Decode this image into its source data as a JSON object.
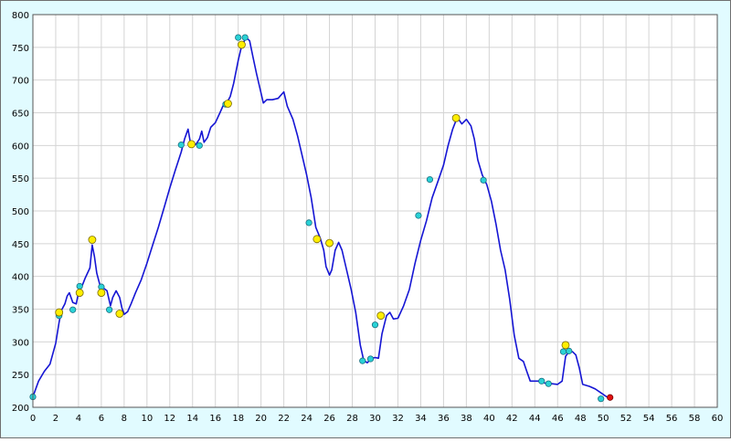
{
  "chart_data": {
    "type": "line",
    "title": "",
    "xlabel": "",
    "ylabel": "",
    "xlim": [
      0,
      60
    ],
    "ylim": [
      200,
      800
    ],
    "xticks": [
      0,
      2,
      4,
      6,
      8,
      10,
      12,
      14,
      16,
      18,
      20,
      22,
      24,
      26,
      28,
      30,
      32,
      34,
      36,
      38,
      40,
      42,
      44,
      46,
      48,
      50,
      52,
      54,
      56,
      58,
      60
    ],
    "yticks": [
      200,
      250,
      300,
      350,
      400,
      450,
      500,
      550,
      600,
      650,
      700,
      750,
      800
    ],
    "grid": true,
    "background": "#e1fbff",
    "plot_background": "#ffffff",
    "grid_color": "#d4d4d4",
    "line_color": "#1515d4",
    "series": [
      {
        "points": [
          [
            0,
            216
          ],
          [
            0.5,
            240
          ],
          [
            1,
            255
          ],
          [
            1.5,
            266
          ],
          [
            2,
            298
          ],
          [
            2.3,
            330
          ],
          [
            2.5,
            348
          ],
          [
            2.8,
            358
          ],
          [
            3,
            370
          ],
          [
            3.2,
            375
          ],
          [
            3.5,
            360
          ],
          [
            3.8,
            358
          ],
          [
            4,
            375
          ],
          [
            4.3,
            385
          ],
          [
            4.6,
            398
          ],
          [
            5,
            413
          ],
          [
            5.2,
            448
          ],
          [
            5.4,
            430
          ],
          [
            5.6,
            405
          ],
          [
            5.9,
            385
          ],
          [
            6.2,
            382
          ],
          [
            6.5,
            378
          ],
          [
            6.8,
            355
          ],
          [
            7,
            368
          ],
          [
            7.3,
            378
          ],
          [
            7.6,
            368
          ],
          [
            7.8,
            352
          ],
          [
            8,
            342
          ],
          [
            8.3,
            346
          ],
          [
            8.6,
            358
          ],
          [
            9,
            375
          ],
          [
            9.5,
            395
          ],
          [
            10,
            420
          ],
          [
            10.5,
            448
          ],
          [
            11,
            475
          ],
          [
            11.5,
            505
          ],
          [
            12,
            535
          ],
          [
            12.5,
            563
          ],
          [
            13,
            590
          ],
          [
            13.3,
            610
          ],
          [
            13.6,
            625
          ],
          [
            13.8,
            605
          ],
          [
            14,
            600
          ],
          [
            14.3,
            602
          ],
          [
            14.6,
            610
          ],
          [
            14.8,
            622
          ],
          [
            15,
            605
          ],
          [
            15.3,
            612
          ],
          [
            15.6,
            628
          ],
          [
            16,
            635
          ],
          [
            16.4,
            650
          ],
          [
            16.7,
            662
          ],
          [
            17,
            665
          ],
          [
            17.3,
            675
          ],
          [
            17.6,
            695
          ],
          [
            18,
            730
          ],
          [
            18.3,
            752
          ],
          [
            18.7,
            765
          ],
          [
            19,
            760
          ],
          [
            19.3,
            735
          ],
          [
            19.6,
            710
          ],
          [
            20,
            680
          ],
          [
            20.2,
            665
          ],
          [
            20.5,
            670
          ],
          [
            21,
            670
          ],
          [
            21.5,
            672
          ],
          [
            22,
            682
          ],
          [
            22.3,
            660
          ],
          [
            22.8,
            640
          ],
          [
            23.2,
            615
          ],
          [
            23.6,
            585
          ],
          [
            24,
            555
          ],
          [
            24.4,
            520
          ],
          [
            24.8,
            475
          ],
          [
            25.2,
            458
          ],
          [
            25.5,
            440
          ],
          [
            25.7,
            415
          ],
          [
            26,
            402
          ],
          [
            26.2,
            410
          ],
          [
            26.5,
            440
          ],
          [
            26.8,
            452
          ],
          [
            27.1,
            440
          ],
          [
            27.5,
            410
          ],
          [
            27.9,
            380
          ],
          [
            28.3,
            345
          ],
          [
            28.7,
            295
          ],
          [
            29,
            272
          ],
          [
            29.3,
            268
          ],
          [
            29.7,
            275
          ],
          [
            30,
            276
          ],
          [
            30.3,
            275
          ],
          [
            30.6,
            312
          ],
          [
            31,
            340
          ],
          [
            31.3,
            345
          ],
          [
            31.6,
            335
          ],
          [
            32,
            336
          ],
          [
            32.5,
            355
          ],
          [
            33,
            380
          ],
          [
            33.5,
            420
          ],
          [
            34,
            455
          ],
          [
            34.5,
            485
          ],
          [
            35,
            520
          ],
          [
            35.5,
            545
          ],
          [
            36,
            570
          ],
          [
            36.4,
            600
          ],
          [
            36.8,
            625
          ],
          [
            37.2,
            643
          ],
          [
            37.6,
            633
          ],
          [
            38,
            640
          ],
          [
            38.4,
            630
          ],
          [
            38.7,
            610
          ],
          [
            39,
            578
          ],
          [
            39.4,
            555
          ],
          [
            39.8,
            540
          ],
          [
            40.2,
            515
          ],
          [
            40.6,
            480
          ],
          [
            41,
            440
          ],
          [
            41.4,
            410
          ],
          [
            41.8,
            365
          ],
          [
            42.2,
            310
          ],
          [
            42.6,
            275
          ],
          [
            43,
            270
          ],
          [
            43.3,
            255
          ],
          [
            43.6,
            240
          ],
          [
            44,
            240
          ],
          [
            44.5,
            240
          ],
          [
            45,
            236
          ],
          [
            45.5,
            236
          ],
          [
            46,
            235
          ],
          [
            46.4,
            240
          ],
          [
            46.7,
            278
          ],
          [
            47,
            285
          ],
          [
            47.3,
            285
          ],
          [
            47.6,
            280
          ],
          [
            47.9,
            260
          ],
          [
            48.2,
            235
          ],
          [
            48.8,
            232
          ],
          [
            49.3,
            228
          ],
          [
            49.8,
            222
          ],
          [
            50.3,
            216
          ],
          [
            50.5,
            216
          ]
        ]
      }
    ],
    "markers": {
      "cyan": [
        [
          0,
          216
        ],
        [
          2.3,
          340
        ],
        [
          3.5,
          349
        ],
        [
          4.1,
          385
        ],
        [
          6.0,
          384
        ],
        [
          6.7,
          349
        ],
        [
          13.0,
          601
        ],
        [
          14.6,
          600
        ],
        [
          16.9,
          663
        ],
        [
          18.0,
          765
        ],
        [
          18.6,
          765
        ],
        [
          24.2,
          482
        ],
        [
          28.9,
          271
        ],
        [
          29.6,
          274
        ],
        [
          30.0,
          326
        ],
        [
          33.8,
          493
        ],
        [
          34.8,
          548
        ],
        [
          39.5,
          547
        ],
        [
          44.6,
          240
        ],
        [
          45.2,
          236
        ],
        [
          46.5,
          285
        ],
        [
          47.0,
          286
        ],
        [
          49.8,
          213
        ]
      ],
      "yellow": [
        [
          2.3,
          345
        ],
        [
          4.1,
          375
        ],
        [
          5.2,
          456
        ],
        [
          6.0,
          375
        ],
        [
          7.6,
          343
        ],
        [
          13.9,
          602
        ],
        [
          17.1,
          664
        ],
        [
          18.3,
          754
        ],
        [
          24.9,
          457
        ],
        [
          26.0,
          451
        ],
        [
          30.5,
          340
        ],
        [
          37.1,
          642
        ],
        [
          46.7,
          295
        ]
      ],
      "red": [
        [
          50.6,
          215
        ]
      ]
    },
    "marker_colors": {
      "cyan": "#2ad2d6",
      "yellow": "#ffee00",
      "red": "#e01010"
    }
  }
}
